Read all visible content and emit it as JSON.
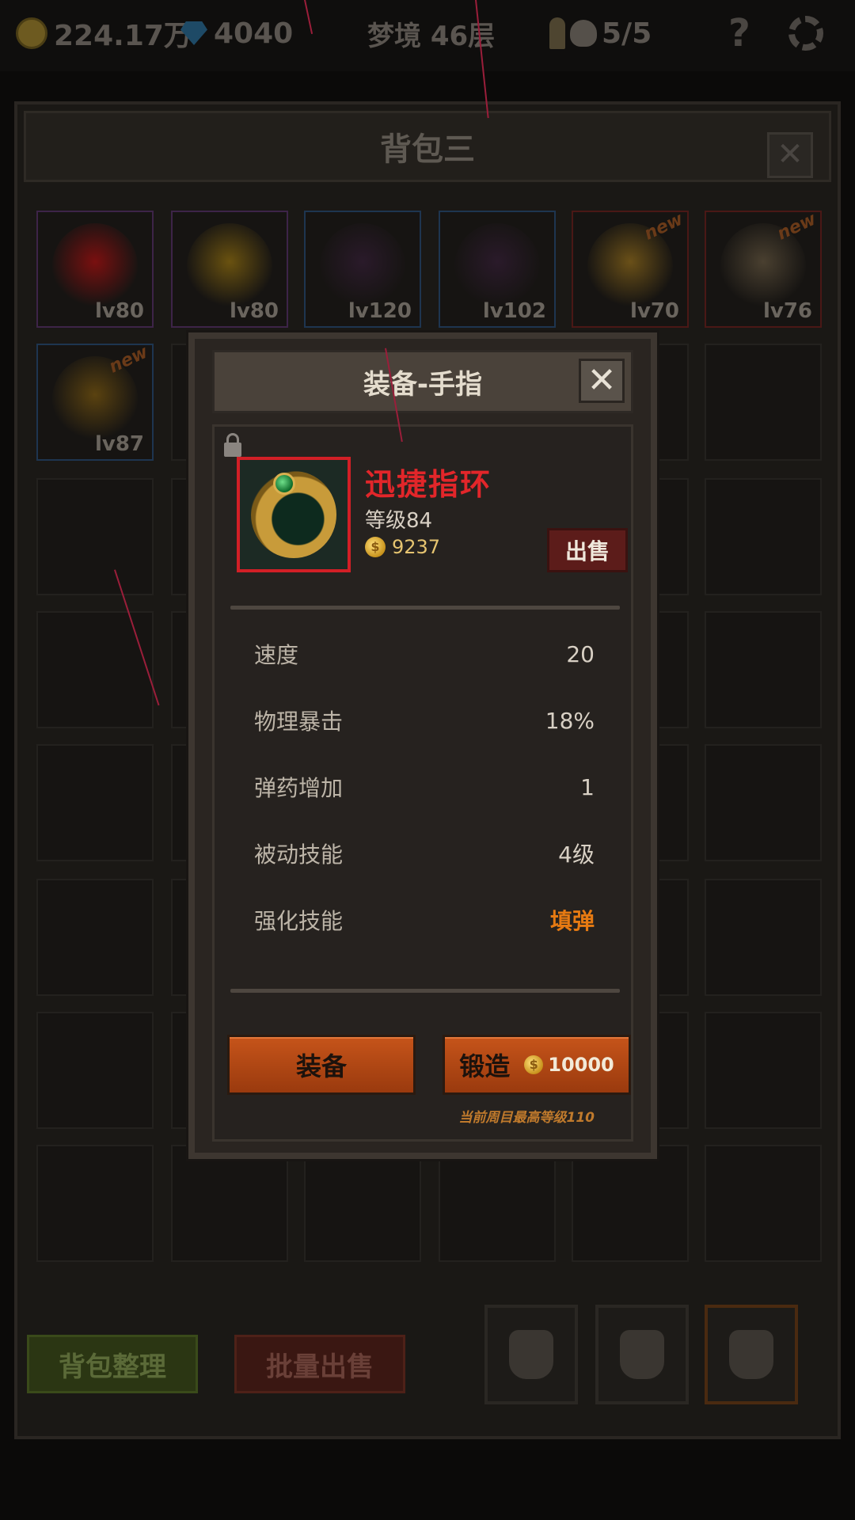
{
  "topbar": {
    "gold": "224.17万",
    "gems": "4040",
    "dream_floor": "梦境 46层",
    "skull_count": "5/5",
    "help": "?"
  },
  "bag": {
    "title": "背包三",
    "close": "✕",
    "items": [
      {
        "lv": "lv80",
        "quality": "purple",
        "new": false,
        "art": "#7a1010"
      },
      {
        "lv": "lv80",
        "quality": "purple",
        "new": false,
        "art": "#6a5210"
      },
      {
        "lv": "lv120",
        "quality": "blue",
        "new": false,
        "art": "#2a1a2a"
      },
      {
        "lv": "lv102",
        "quality": "blue",
        "new": false,
        "art": "#2a1a2a"
      },
      {
        "lv": "lv70",
        "quality": "red",
        "new": true,
        "art": "#6a5018"
      },
      {
        "lv": "lv76",
        "quality": "red",
        "new": true,
        "art": "#4a4030"
      },
      {
        "lv": "lv87",
        "quality": "blue",
        "new": true,
        "art": "#5a4210"
      }
    ],
    "new_tag": "new",
    "sort_button": "背包整理",
    "bulk_sell_button": "批量出售"
  },
  "modal": {
    "title": "装备-手指",
    "close": "✕",
    "item_name": "迅捷指环",
    "item_level": "等级84",
    "price": "9237",
    "sell_button": "出售",
    "stats": [
      {
        "label": "速度",
        "value": "20"
      },
      {
        "label": "物理暴击",
        "value": "18%"
      },
      {
        "label": "弹药增加",
        "value": "1"
      },
      {
        "label": "被动技能",
        "value": "4级"
      },
      {
        "label": "强化技能",
        "value": "填弹"
      }
    ],
    "equip_button": "装备",
    "forge_button": "锻造",
    "forge_cost": "10000",
    "max_level_note": "当前周目最高等级110"
  },
  "colors": {
    "item_name": "#e2262a",
    "highlight_value": "#e67a12",
    "action_button": "#c6541a"
  }
}
